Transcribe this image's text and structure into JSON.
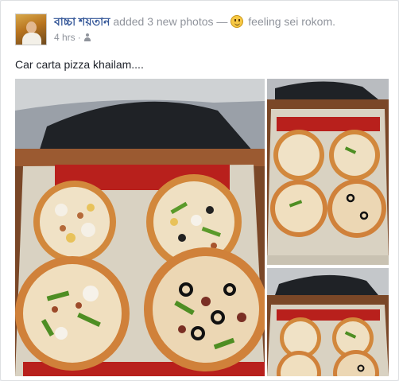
{
  "post": {
    "author_name": "বাচ্চা শয়তান",
    "action_text": "added 3 new photos —",
    "feeling_icon": "smiley-face-icon",
    "feeling_text": "feeling sei rokom.",
    "timestamp": "4 hrs",
    "separator": "·",
    "audience_icon": "friends-icon",
    "caption": "Car carta pizza khailam....",
    "photos": [
      {
        "icon": "pizza-photo"
      },
      {
        "icon": "pizza-photo"
      },
      {
        "icon": "pizza-photo"
      }
    ]
  },
  "colors": {
    "author_link": "#365899",
    "meta_gray": "#90949c",
    "text": "#1d2129",
    "box_red": "#b8201c",
    "table_wood": "#8a4e2a"
  }
}
